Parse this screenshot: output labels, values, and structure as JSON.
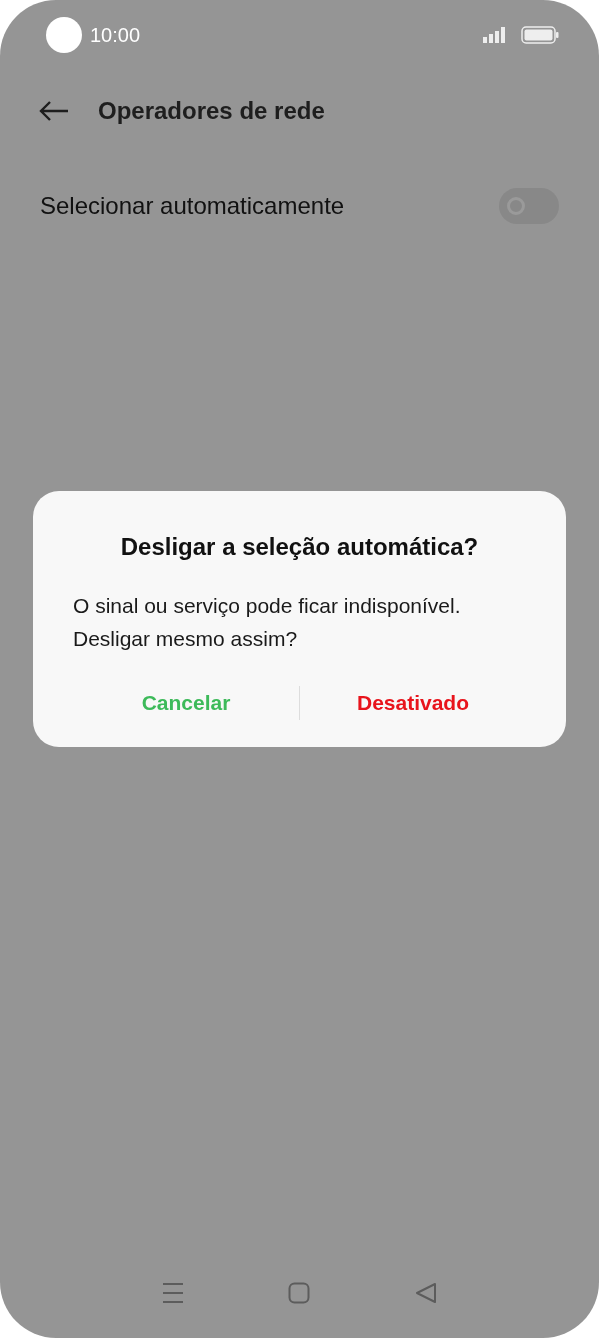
{
  "status_bar": {
    "time": "10:00"
  },
  "header": {
    "title": "Operadores de rede"
  },
  "settings": [
    {
      "label": "Selecionar automaticamente",
      "on": false
    }
  ],
  "dialog": {
    "title": "Desligar a seleção automática?",
    "message": "O sinal ou serviço pode ficar indisponível. Desligar mesmo assim?",
    "buttons": [
      {
        "label": "Cancelar",
        "color": "#3dba5a"
      },
      {
        "label": "Desativado",
        "color": "#e8141c"
      }
    ]
  }
}
